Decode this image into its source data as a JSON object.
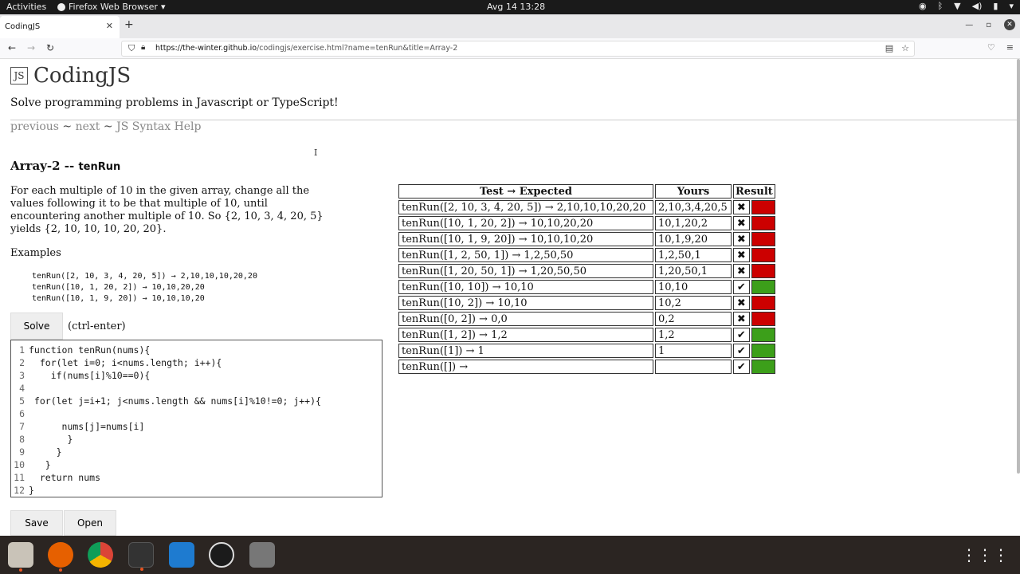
{
  "topbar": {
    "activities": "Activities",
    "app_name": "Firefox Web Browser",
    "clock": "Avg 14  13:28"
  },
  "browser": {
    "tab_title": "CodingJS",
    "url_host": "https://the-winter.github.io",
    "url_path": "/codingjs/exercise.html?name=tenRun&title=Array-2"
  },
  "page": {
    "site_title": "CodingJS",
    "tagline": "Solve programming problems in Javascript or TypeScript!",
    "nav": {
      "previous": "previous",
      "sep1": " ~ ",
      "next": "next",
      "sep2": " ~ ",
      "syntax_help": "JS Syntax Help"
    },
    "problem_category": "Array-2 -- ",
    "problem_name": "tenRun",
    "description": "For each multiple of 10 in the given array, change all the values following it to be that multiple of 10, until encountering another multiple of 10. So {2, 10, 3, 4, 20, 5} yields {2, 10, 10, 10, 20, 20}.",
    "examples_label": "Examples",
    "examples": [
      "tenRun([2, 10, 3, 4, 20, 5]) → 2,10,10,10,20,20",
      "tenRun([10, 1, 20, 2]) → 10,10,20,20",
      "tenRun([10, 1, 9, 20]) → 10,10,10,20"
    ],
    "solve_label": "Solve",
    "shortcut": "(ctrl-enter)",
    "save_label": "Save",
    "open_label": "Open"
  },
  "editor": {
    "lines": [
      "function tenRun(nums){",
      "  for(let i=0; i<nums.length; i++){",
      "    if(nums[i]%10==0){",
      "",
      " for(let j=i+1; j<nums.length && nums[i]%10!=0; j++){",
      "",
      "      nums[j]=nums[i]",
      "       }",
      "     }",
      "   }",
      "  return nums",
      "}"
    ]
  },
  "results": {
    "headers": [
      "Test → Expected",
      "Yours",
      "Result"
    ],
    "rows": [
      {
        "test": "tenRun([2, 10, 3, 4, 20, 5]) → 2,10,10,10,20,20",
        "yours": "2,10,3,4,20,5",
        "mark": "✖",
        "pass": false
      },
      {
        "test": "tenRun([10, 1, 20, 2]) → 10,10,20,20",
        "yours": "10,1,20,2",
        "mark": "✖",
        "pass": false
      },
      {
        "test": "tenRun([10, 1, 9, 20]) → 10,10,10,20",
        "yours": "10,1,9,20",
        "mark": "✖",
        "pass": false
      },
      {
        "test": "tenRun([1, 2, 50, 1]) → 1,2,50,50",
        "yours": "1,2,50,1",
        "mark": "✖",
        "pass": false
      },
      {
        "test": "tenRun([1, 20, 50, 1]) → 1,20,50,50",
        "yours": "1,20,50,1",
        "mark": "✖",
        "pass": false
      },
      {
        "test": "tenRun([10, 10]) → 10,10",
        "yours": "10,10",
        "mark": "✔",
        "pass": true
      },
      {
        "test": "tenRun([10, 2]) → 10,10",
        "yours": "10,2",
        "mark": "✖",
        "pass": false
      },
      {
        "test": "tenRun([0, 2]) → 0,0",
        "yours": "0,2",
        "mark": "✖",
        "pass": false
      },
      {
        "test": "tenRun([1, 2]) → 1,2",
        "yours": "1,2",
        "mark": "✔",
        "pass": true
      },
      {
        "test": "tenRun([1]) → 1",
        "yours": "1",
        "mark": "✔",
        "pass": true
      },
      {
        "test": "tenRun([]) →",
        "yours": "",
        "mark": "✔",
        "pass": true
      }
    ]
  },
  "colors": {
    "pass": "#3c9f1a",
    "fail": "#cc0000"
  },
  "dock": {
    "apps": [
      "files-icon",
      "firefox-icon",
      "chrome-icon",
      "terminal-icon",
      "vscode-icon",
      "obs-icon",
      "ssd-icon"
    ]
  }
}
